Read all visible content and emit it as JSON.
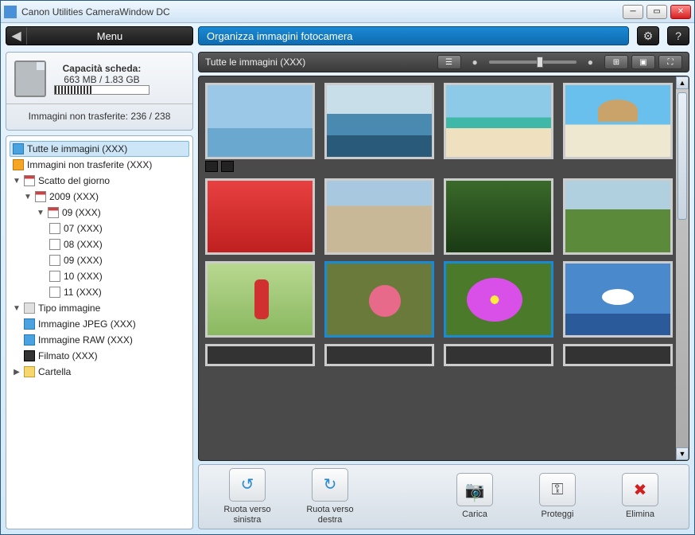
{
  "window": {
    "title": "Canon Utilities CameraWindow DC"
  },
  "toolbar": {
    "menu_label": "Menu",
    "panel_title": "Organizza immagini fotocamera"
  },
  "card": {
    "capacity_label": "Capacità scheda:",
    "capacity_value": "663 MB / 1.83 GB",
    "untransferred_label": "Immagini non trasferite: 236 / 238"
  },
  "tree": {
    "all_images": "Tutte le immagini (XXX)",
    "untransferred": "Immagini non trasferite (XXX)",
    "by_day": "Scatto del giorno",
    "year": "2009 (XXX)",
    "month": "09 (XXX)",
    "days": [
      "07 (XXX)",
      "08 (XXX)",
      "09 (XXX)",
      "10 (XXX)",
      "11 (XXX)"
    ],
    "by_type": "Tipo immagine",
    "jpeg": "Immagine JPEG (XXX)",
    "raw": "Immagine RAW (XXX)",
    "movie": "Filmato (XXX)",
    "folder": "Cartella"
  },
  "grid": {
    "header_label": "Tutte le immagini (XXX)"
  },
  "actions": {
    "rotate_left": "Ruota verso sinistra",
    "rotate_right": "Ruota verso destra",
    "upload": "Carica",
    "protect": "Proteggi",
    "delete": "Elimina"
  }
}
